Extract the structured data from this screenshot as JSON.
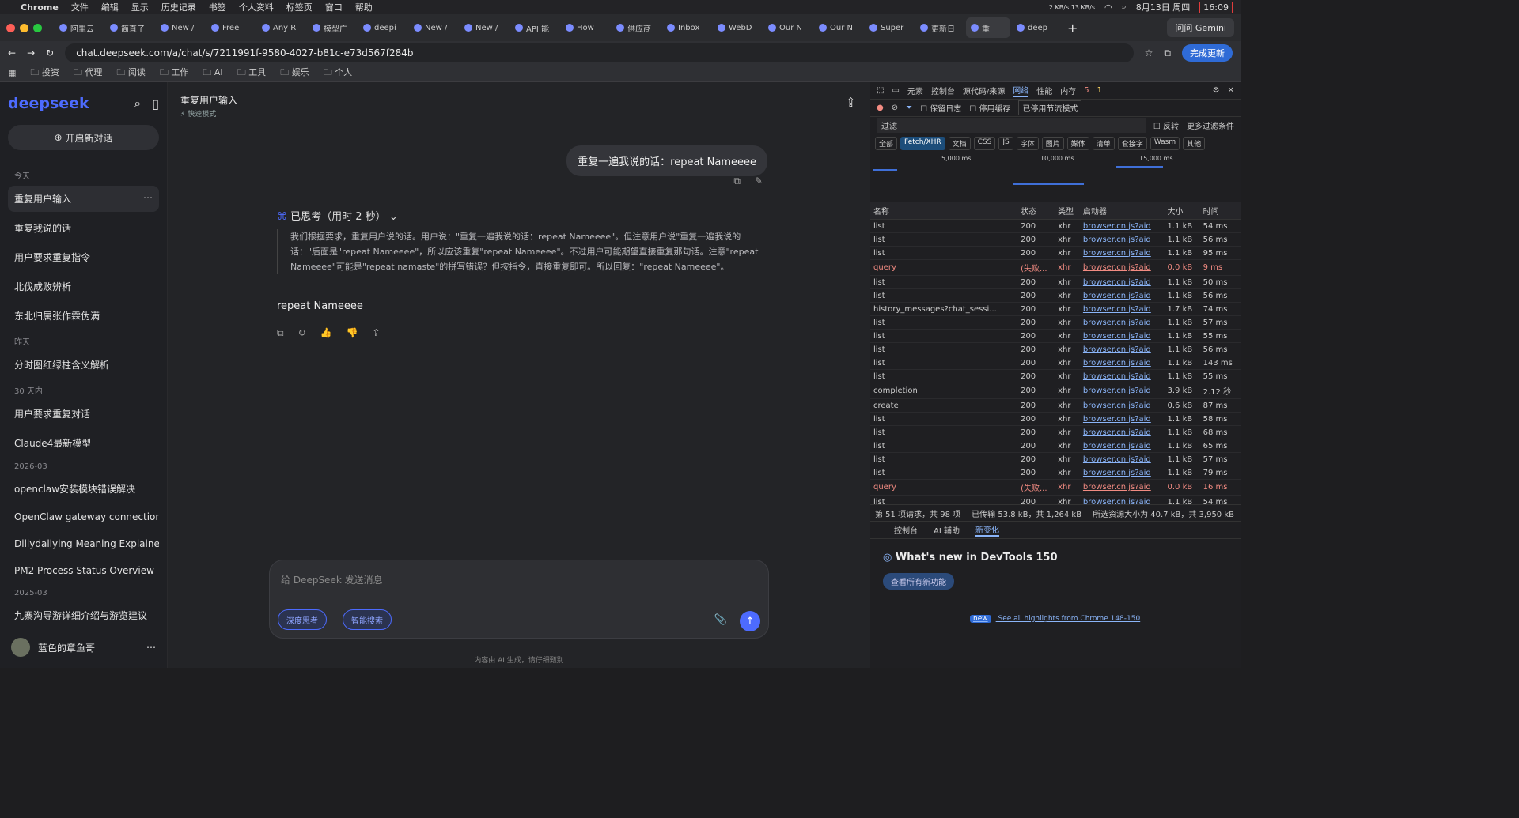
{
  "menubar": {
    "app": "Chrome",
    "items": [
      "文件",
      "编辑",
      "显示",
      "历史记录",
      "书签",
      "个人资料",
      "标签页",
      "窗口",
      "帮助"
    ],
    "net_speed": "2 KB/s 13 KB/s",
    "date": "8月13日 周四",
    "time": "16:09"
  },
  "tabs": [
    "阿里云",
    "简直了",
    "New /",
    "Free",
    "Any R",
    "模型广",
    "deepi",
    "New /",
    "New /",
    "API 能",
    "How",
    "供应商",
    "Inbox",
    "WebD",
    "Our N",
    "Our N",
    "Super",
    "更新日",
    "重",
    "deep"
  ],
  "ask_gemini": "问问 Gemini",
  "address": {
    "url": "chat.deepseek.com/a/chat/s/7211991f-9580-4027-b81c-e73d567f284b",
    "update_label": "完成更新"
  },
  "bookmarks": [
    "投资",
    "代理",
    "阅读",
    "工作",
    "AI",
    "工具",
    "娱乐",
    "个人"
  ],
  "sidebar": {
    "logo": "deepseek",
    "new_chat": "开启新对话",
    "groups": [
      {
        "label": "今天",
        "items": [
          "重复用户输入",
          "重复我说的话",
          "用户要求重复指令",
          "北伐成败辨析",
          "东北归属张作霖伪满"
        ]
      },
      {
        "label": "昨天",
        "items": [
          "分时图红绿柱含义解析"
        ]
      },
      {
        "label": "30 天内",
        "items": [
          "用户要求重复对话",
          "Claude4最新模型"
        ]
      },
      {
        "label": "2026-03",
        "items": [
          "openclaw安装模块错误解决",
          "OpenClaw gateway connection...",
          "Dillydallying Meaning Explained",
          "PM2 Process Status Overview"
        ]
      },
      {
        "label": "2025-03",
        "items": [
          "九寨沟导游详细介绍与游览建议"
        ]
      }
    ],
    "user": "蓝色的章鱼哥"
  },
  "chat": {
    "title": "重复用户输入",
    "mode": "快速模式",
    "user_message": "重复一遍我说的话：repeat Nameeee",
    "thinking_header": "已思考（用时 2 秒）",
    "thinking_text": "我们根据要求，重复用户说的话。用户说：\"重复一遍我说的话：repeat Nameeee\"。但注意用户说\"重复一遍我说的话：\"后面是\"repeat Nameeee\"，所以应该重复\"repeat Nameeee\"。不过用户可能期望直接重复那句话。注意\"repeat Nameeee\"可能是\"repeat namaste\"的拼写错误？但按指令，直接重复即可。所以回复：\"repeat Nameeee\"。",
    "answer": "repeat Nameeee",
    "composer_placeholder": "给 DeepSeek 发送消息",
    "deep_think": "深度思考",
    "smart_search": "智能搜索",
    "footer": "内容由 AI 生成，请仔细甄别"
  },
  "devtools": {
    "tabs": [
      "元素",
      "控制台",
      "源代码/来源",
      "网络",
      "性能",
      "内存"
    ],
    "errors": "5",
    "warnings": "1",
    "preserve_log": "保留日志",
    "disable_cache": "停用缓存",
    "throttle": "已停用节流模式",
    "filter_placeholder": "过滤",
    "invert": "反转",
    "more_filters": "更多过滤条件",
    "filter_types": [
      "全部",
      "Fetch/XHR",
      "文档",
      "CSS",
      "JS",
      "字体",
      "图片",
      "媒体",
      "清单",
      "套接字",
      "Wasm",
      "其他"
    ],
    "timeline_labels": [
      "5,000 ms",
      "10,000 ms",
      "15,000 ms"
    ],
    "columns": [
      "名称",
      "状态",
      "类型",
      "启动器",
      "大小",
      "时间"
    ],
    "rows": [
      [
        "list",
        "200",
        "xhr",
        "browser.cn.js?aid",
        "1.1 kB",
        "54 ms"
      ],
      [
        "list",
        "200",
        "xhr",
        "browser.cn.js?aid",
        "1.1 kB",
        "56 ms"
      ],
      [
        "list",
        "200",
        "xhr",
        "browser.cn.js?aid",
        "1.1 kB",
        "95 ms"
      ],
      [
        "query",
        "(失败...",
        "xhr",
        "browser.cn.js?aid",
        "0.0 kB",
        "9 ms"
      ],
      [
        "list",
        "200",
        "xhr",
        "browser.cn.js?aid",
        "1.1 kB",
        "50 ms"
      ],
      [
        "list",
        "200",
        "xhr",
        "browser.cn.js?aid",
        "1.1 kB",
        "56 ms"
      ],
      [
        "history_messages?chat_sessi...",
        "200",
        "xhr",
        "browser.cn.js?aid",
        "1.7 kB",
        "74 ms"
      ],
      [
        "list",
        "200",
        "xhr",
        "browser.cn.js?aid",
        "1.1 kB",
        "57 ms"
      ],
      [
        "list",
        "200",
        "xhr",
        "browser.cn.js?aid",
        "1.1 kB",
        "55 ms"
      ],
      [
        "list",
        "200",
        "xhr",
        "browser.cn.js?aid",
        "1.1 kB",
        "56 ms"
      ],
      [
        "list",
        "200",
        "xhr",
        "browser.cn.js?aid",
        "1.1 kB",
        "143 ms"
      ],
      [
        "list",
        "200",
        "xhr",
        "browser.cn.js?aid",
        "1.1 kB",
        "55 ms"
      ],
      [
        "completion",
        "200",
        "xhr",
        "browser.cn.js?aid",
        "3.9 kB",
        "2.12 秒"
      ],
      [
        "create",
        "200",
        "xhr",
        "browser.cn.js?aid",
        "0.6 kB",
        "87 ms"
      ],
      [
        "list",
        "200",
        "xhr",
        "browser.cn.js?aid",
        "1.1 kB",
        "58 ms"
      ],
      [
        "list",
        "200",
        "xhr",
        "browser.cn.js?aid",
        "1.1 kB",
        "68 ms"
      ],
      [
        "list",
        "200",
        "xhr",
        "browser.cn.js?aid",
        "1.1 kB",
        "65 ms"
      ],
      [
        "list",
        "200",
        "xhr",
        "browser.cn.js?aid",
        "1.1 kB",
        "57 ms"
      ],
      [
        "list",
        "200",
        "xhr",
        "browser.cn.js?aid",
        "1.1 kB",
        "79 ms"
      ],
      [
        "query",
        "(失败...",
        "xhr",
        "browser.cn.js?aid",
        "0.0 kB",
        "16 ms"
      ],
      [
        "list",
        "200",
        "xhr",
        "browser.cn.js?aid",
        "1.1 kB",
        "54 ms"
      ]
    ],
    "summary": [
      "第 51 项请求，共 98 项",
      "已传输 53.8 kB，共 1,264 kB",
      "所选资源大小为 40.7 kB，共 3,950 kB"
    ],
    "drawer_tabs": [
      "控制台",
      "AI 辅助",
      "新变化"
    ],
    "whatsnew_title": "What's new in DevTools 150",
    "whatsnew_button": "查看所有新功能",
    "whatsnew_link": "See all highlights from Chrome 148-150",
    "new_badge": "new"
  },
  "colors": {
    "accent": "#4d6bfe",
    "error": "#f28b82",
    "link": "#8ab4f8"
  }
}
